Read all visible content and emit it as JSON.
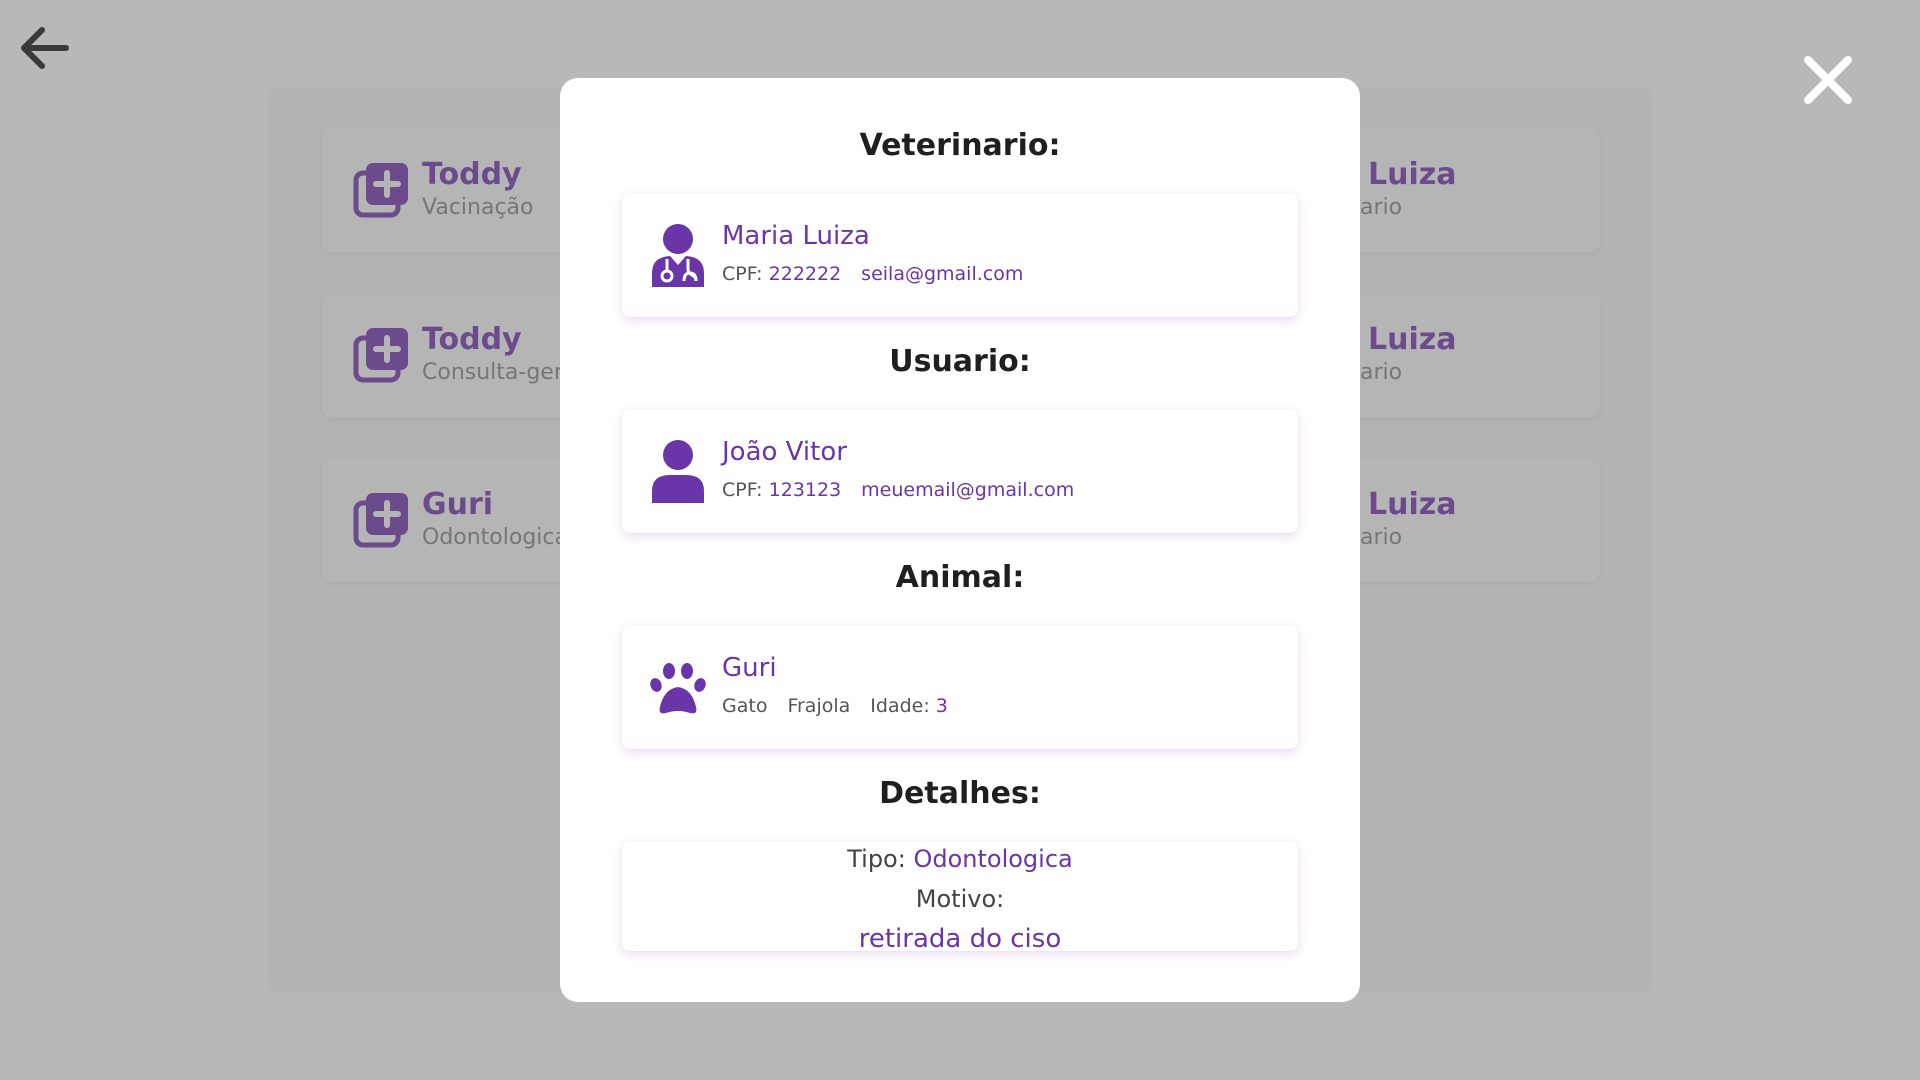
{
  "background": {
    "cards_left": [
      {
        "name": "Toddy",
        "sub": "Vacinação"
      },
      {
        "name": "Toddy",
        "sub": "Consulta-geral"
      },
      {
        "name": "Guri",
        "sub": "Odontologica"
      }
    ],
    "cards_right": [
      {
        "name": "Luiza",
        "sub": "ario"
      },
      {
        "name": "Luiza",
        "sub": "ario"
      },
      {
        "name": "Luiza",
        "sub": "ario"
      }
    ]
  },
  "modal": {
    "vet_heading": "Veterinario:",
    "vet": {
      "name": "Maria Luiza",
      "cpf_label": "CPF:",
      "cpf": "222222",
      "email": "seila@gmail.com"
    },
    "user_heading": "Usuario:",
    "user": {
      "name": "João Vitor",
      "cpf_label": "CPF:",
      "cpf": "123123",
      "email": "meuemail@gmail.com"
    },
    "animal_heading": "Animal:",
    "animal": {
      "name": "Guri",
      "species": "Gato",
      "breed": "Frajola",
      "age_label": "Idade:",
      "age": "3"
    },
    "details_heading": "Detalhes:",
    "details": {
      "type_label": "Tipo:",
      "type": "Odontologica",
      "reason_label": "Motivo:",
      "reason": "retirada do ciso"
    }
  },
  "colors": {
    "accent": "#6a35a8",
    "overlay": "#b8b8b8"
  },
  "icons": [
    "arrow-left-icon",
    "close-icon",
    "medical-plus-icon",
    "doctor-icon",
    "user-icon",
    "paw-icon"
  ]
}
